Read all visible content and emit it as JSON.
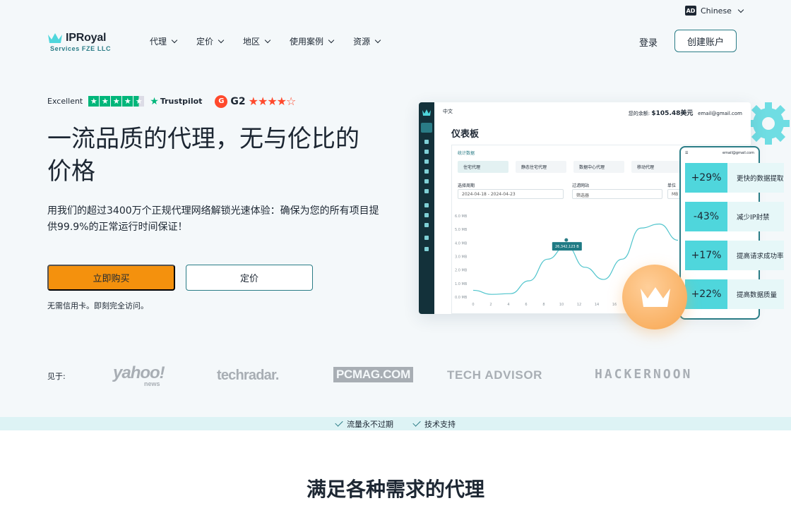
{
  "lang": {
    "icon": "AD",
    "label": "Chinese"
  },
  "logo": {
    "name": "IPRoyal",
    "sub": "Services FZE LLC"
  },
  "nav": [
    {
      "label": "代理"
    },
    {
      "label": "定价"
    },
    {
      "label": "地区"
    },
    {
      "label": "使用案例"
    },
    {
      "label": "资源"
    }
  ],
  "header": {
    "login": "登录",
    "signup": "创建账户"
  },
  "ratings": {
    "excellent": "Excellent",
    "trustpilot": "Trustpilot",
    "g2": "G2"
  },
  "hero": {
    "headline": "一流品质的代理，无与伦比的价格",
    "subtext": "用我们的超过3400万个正规代理网络解锁光速体验：确保为您的所有项目提供99.9%的正常运行时间保证！",
    "buy": "立即购买",
    "pricing": "定价",
    "note": "无需信用卡。即刻完全访问。"
  },
  "dashboard": {
    "lang": "中文",
    "balance_label": "您的余额:",
    "balance": "$105.48美元",
    "email": "email@gmail.com",
    "title": "仪表板",
    "panel_label": "统计数据",
    "tabs": [
      "住宅代理",
      "静态住宅代理",
      "数据中心代理",
      "移动代理"
    ],
    "date_label": "选择周期",
    "date_value": "2024-04-18 - 2024-04-23",
    "filter_label": "过滤网站",
    "filter_placeholder": "筛选器",
    "unit_label": "单位",
    "unit_value": "MB",
    "tooltip": "26,342,123 B"
  },
  "chart_data": {
    "type": "line",
    "x": [
      0,
      2,
      4,
      6,
      8,
      10,
      12,
      14,
      16,
      18,
      20
    ],
    "x_ticks": [
      "0",
      "2",
      "4",
      "6",
      "8",
      "10",
      "12",
      "14",
      "16",
      "18",
      "20"
    ],
    "y_ticks": [
      "0.0 MB",
      "1.0 MB",
      "2.0 MB",
      "3.0 MB",
      "4.0 MB",
      "5.0 MB",
      "6.0 MB"
    ],
    "ylim": [
      0,
      6
    ],
    "values": [
      0.5,
      0.2,
      0.25,
      1.2,
      2.8,
      3.8,
      2.2,
      1.3,
      2.8,
      5.1,
      5.4,
      4.2
    ]
  },
  "phone": {
    "email": "email@gmail.com"
  },
  "stats": [
    {
      "value": "+29%",
      "label": "更快的数据提取"
    },
    {
      "value": "-43%",
      "label": "减少IP封禁"
    },
    {
      "value": "+17%",
      "label": "提高请求成功率"
    },
    {
      "value": "+22%",
      "label": "提高数据质量"
    }
  ],
  "press": {
    "label": "见于:",
    "yahoo": "yahoo!",
    "yahoo_sub": "news",
    "techradar": "techradar.",
    "pcmag": "PCMAG.COM",
    "techadvisor": "TECH ADVISOR",
    "hackernoon": "HACKERNOON"
  },
  "strip": [
    "流量永不过期",
    "技术支持"
  ],
  "section_title": "满足各种需求的代理",
  "colors": {
    "accent": "#2a7c86",
    "orange": "#f4910d",
    "cyan": "#4fd6dc"
  }
}
